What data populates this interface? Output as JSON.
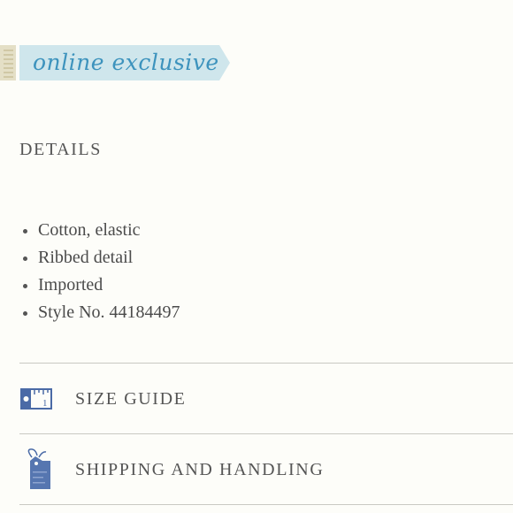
{
  "badge": {
    "label": "online exclusive"
  },
  "details": {
    "heading": "DETAILS",
    "items": [
      "Cotton, elastic",
      "Ribbed detail",
      "Imported",
      "Style No. 44184497"
    ]
  },
  "accordion": [
    {
      "label": "SIZE GUIDE",
      "icon": "ruler-icon"
    },
    {
      "label": "SHIPPING AND HANDLING",
      "icon": "shipping-tag-icon"
    }
  ],
  "colors": {
    "ribbon": "#cfe6ec",
    "ribbon_text": "#3d93bd",
    "icon_blue": "#4a6aa6",
    "divider": "#c9c9c3"
  }
}
